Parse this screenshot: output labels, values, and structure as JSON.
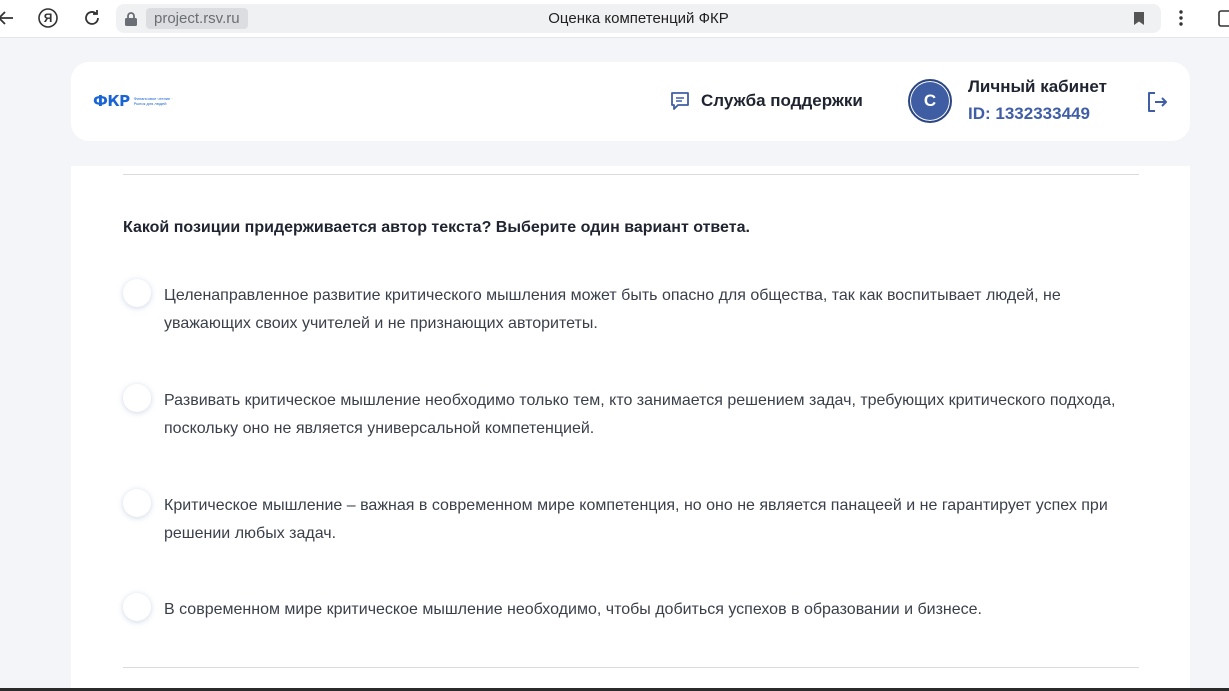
{
  "browser": {
    "domain": "project.rsv.ru",
    "tab_title": "Оценка компетенций ФКР",
    "yandex_glyph": "Я"
  },
  "header": {
    "logo_text": "ФКР",
    "logo_caption": "Финансовое чтение · Рынок для людей",
    "support_label": "Служба поддержки",
    "avatar_initial": "С",
    "profile_title": "Личный кабинет",
    "profile_id": "ID: 1332333449"
  },
  "question": {
    "text": "Какой позиции придерживается автор текста? Выберите один вариант ответа.",
    "options": [
      {
        "label": "Целенаправленное развитие критического мышления может быть опасно для общества, так как воспитывает людей, не уважающих своих учителей и не признающих авторитеты."
      },
      {
        "label": "Развивать критическое мышление необходимо только тем, кто занимается решением задач, требующих критического подхода, поскольку оно не является универсальной компетенцией."
      },
      {
        "label": "Критическое мышление – важная в современном мире компетенция, но оно не является панацеей и не гарантирует успех при решении любых задач."
      },
      {
        "label": "В современном мире критическое мышление необходимо, чтобы добиться успехов в образовании и бизнесе."
      }
    ]
  },
  "colors": {
    "accent": "#3f5ea5",
    "logo": "#1a64d6",
    "page_bg": "#f3f5f9"
  }
}
